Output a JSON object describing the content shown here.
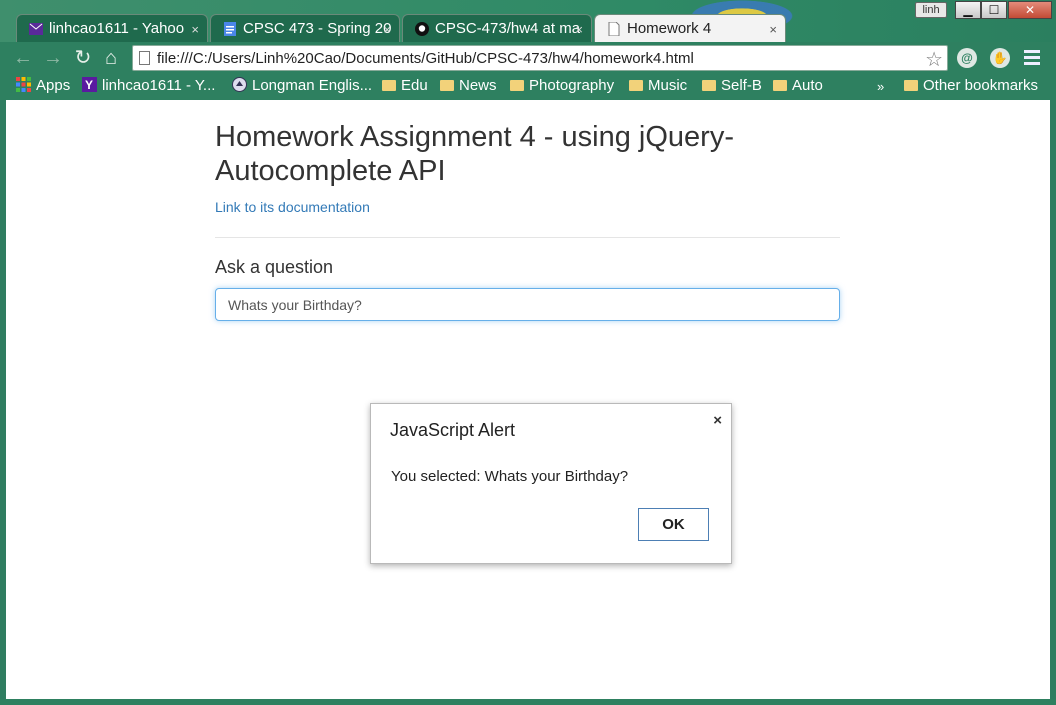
{
  "browser": {
    "user_label": "linh",
    "tabs": [
      {
        "title": "linhcao1611 - Yahoo",
        "icon": "yahoo-mail-icon"
      },
      {
        "title": "CPSC 473 - Spring 20",
        "icon": "docs-icon"
      },
      {
        "title": "CPSC-473/hw4 at ma",
        "icon": "github-icon"
      },
      {
        "title": "Homework 4",
        "icon": "page-icon"
      }
    ],
    "tab_close_glyph": "×",
    "url": "file:///C:/Users/Linh%20Cao/Documents/GitHub/CPSC-473/hw4/homework4.html",
    "window_buttons": {
      "minimize": "▁",
      "maximize": "☐",
      "close": "✕"
    }
  },
  "bookmarks": {
    "items": [
      "Apps",
      "linhcao1611 - Y...",
      "Longman Englis...",
      "Edu",
      "News",
      "Photography",
      "Music",
      "Self-B",
      "Auto"
    ],
    "overflow": "»",
    "other": "Other bookmarks"
  },
  "page": {
    "title": "Homework Assignment 4 - using jQuery-Autocomplete API",
    "doc_link": "Link to its documentation",
    "question_label": "Ask a question",
    "question_value": "Whats your Birthday?"
  },
  "alert": {
    "title": "JavaScript Alert",
    "message": "You selected: Whats your Birthday?",
    "ok_label": "OK",
    "close_glyph": "×"
  },
  "colors": {
    "frame": "#2e8060",
    "link": "#337ab7",
    "input_focus": "#66afe9"
  }
}
